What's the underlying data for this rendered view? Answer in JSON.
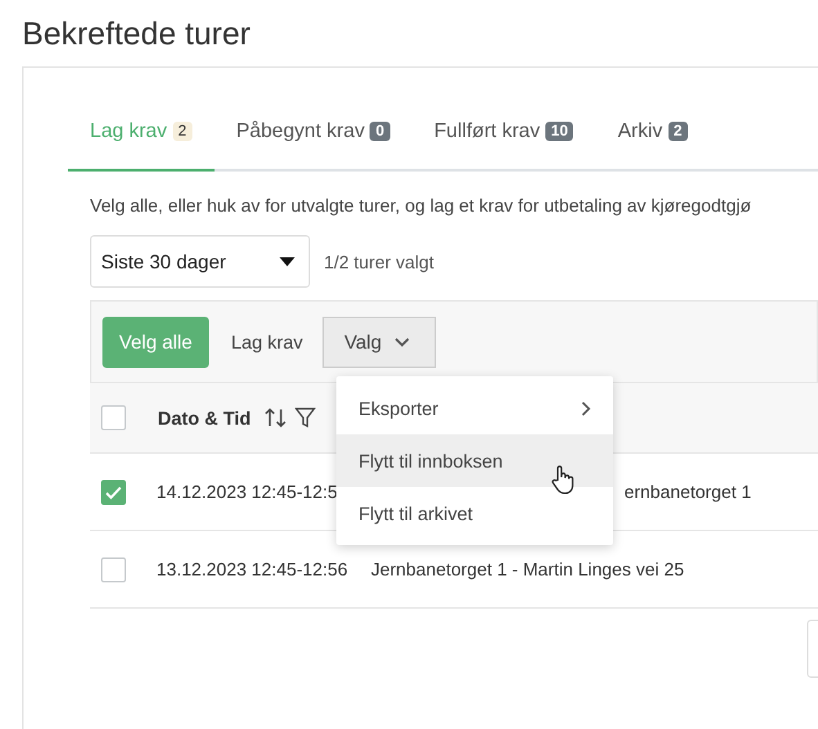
{
  "page": {
    "title": "Bekreftede turer"
  },
  "tabs": [
    {
      "label": "Lag krav",
      "count": "2",
      "selected": true
    },
    {
      "label": "Påbegynt krav",
      "count": "0",
      "selected": false
    },
    {
      "label": "Fullført krav",
      "count": "10",
      "selected": false
    },
    {
      "label": "Arkiv",
      "count": "2",
      "selected": false
    }
  ],
  "description": "Velg alle, eller huk av for utvalgte turer, og lag et krav for utbetaling av kjøregodtgjø",
  "period_select": {
    "value": "Siste 30 dager"
  },
  "selection_count": "1/2 turer valgt",
  "toolbar": {
    "select_all": "Velg alle",
    "create_claim": "Lag krav",
    "options": "Valg"
  },
  "options_menu": [
    {
      "label": "Eksporter",
      "submenu": true,
      "hovered": false
    },
    {
      "label": "Flytt til innboksen",
      "submenu": false,
      "hovered": true
    },
    {
      "label": "Flytt til arkivet",
      "submenu": false,
      "hovered": false
    }
  ],
  "table": {
    "header": {
      "checked": false,
      "column_1": "Dato & Tid"
    },
    "rows": [
      {
        "checked": true,
        "date": "14.12.2023 12:45-12:5",
        "route": "ernbanetorget 1",
        "route_covered": true
      },
      {
        "checked": false,
        "date": "13.12.2023 12:45-12:56",
        "route": "Jernbanetorget 1 - Martin Linges vei 25",
        "route_covered": false
      }
    ]
  }
}
